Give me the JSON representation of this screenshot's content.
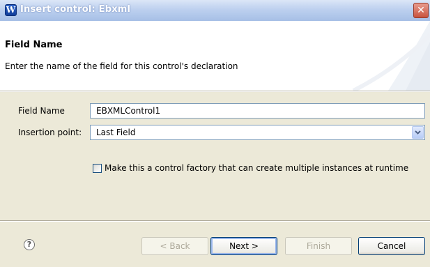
{
  "window": {
    "title": "Insert control: Ebxml",
    "app_icon_glyph": "W",
    "close_glyph": "✕"
  },
  "header": {
    "title": "Field Name",
    "description": "Enter the name of the field for this control's declaration"
  },
  "form": {
    "field_name_label": "Field Name",
    "field_name_value": "EBXMLControl1",
    "insertion_point_label": "Insertion point:",
    "insertion_point_value": "Last Field",
    "factory_checkbox_label": "Make this a control factory that can create multiple instances at runtime",
    "factory_checkbox_checked": false
  },
  "footer": {
    "help_glyph": "?",
    "back_label": "< Back",
    "next_label": "Next >",
    "finish_label": "Finish",
    "cancel_label": "Cancel"
  },
  "icons": {
    "app": "wizard-app-icon",
    "close": "close-icon",
    "help": "help-icon",
    "dropdown": "chevron-down-icon"
  },
  "colors": {
    "titlebar_start": "#dbe6f7",
    "titlebar_end": "#a6bfe6",
    "dialog_bg": "#ece9d8",
    "header_bg": "#ffffff",
    "button_border": "#003c74",
    "disabled_text": "#aca899"
  }
}
